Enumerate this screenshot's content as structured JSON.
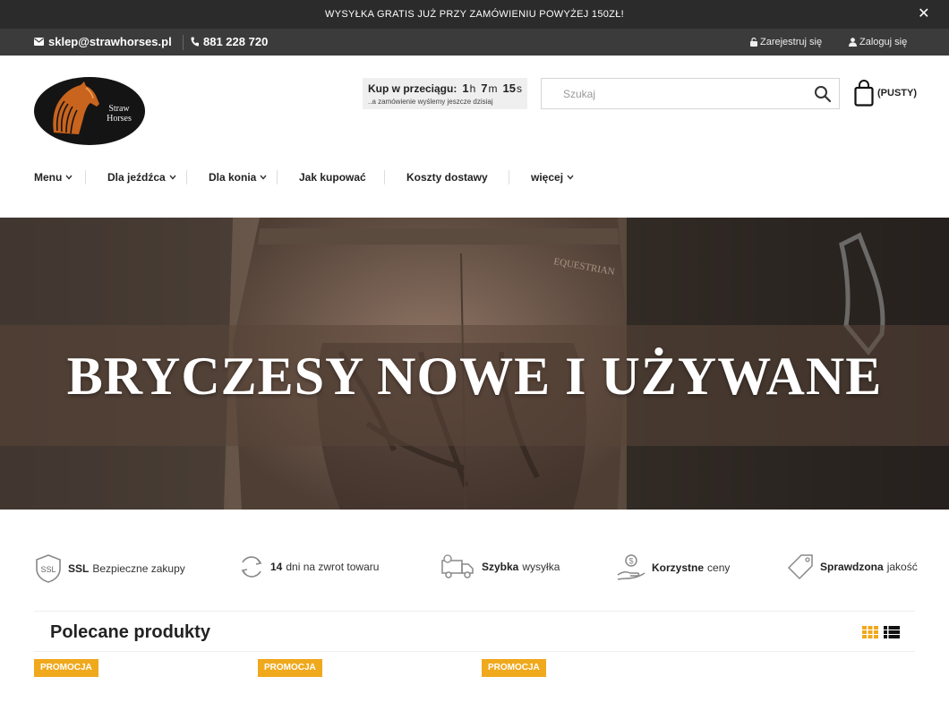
{
  "promo_bar": {
    "text": "WYSYŁKA GRATIS JUŻ PRZY ZAMÓWIENIU POWYŻEJ 150ZŁ!",
    "close_icon": "close-icon"
  },
  "contact": {
    "email": "sklep@strawhorses.pl",
    "phone": "881 228 720"
  },
  "account": {
    "register": "Zarejestruj się",
    "login": "Zaloguj się"
  },
  "logo": {
    "line1": "Straw",
    "line2": "Horses"
  },
  "timer": {
    "label": "Kup w przeciągu:",
    "hours": "1",
    "hours_unit": "h",
    "minutes": "7",
    "minutes_unit": "m",
    "seconds": "15",
    "seconds_unit": "s",
    "subtext": "..a zamówienie wyślemy jeszcze dzisiaj"
  },
  "search": {
    "placeholder": "Szukaj",
    "value": ""
  },
  "cart": {
    "label": "(PUSTY)"
  },
  "nav": {
    "items": [
      {
        "label": "Menu"
      },
      {
        "label": "Dla jeźdźca"
      },
      {
        "label": "Dla konia"
      },
      {
        "label": "Jak kupować"
      },
      {
        "label": "Koszty dostawy"
      },
      {
        "label": "więcej"
      }
    ]
  },
  "banner": {
    "title": "BRYCZESY NOWE I UŻYWANE",
    "garment_text": "EQUESTRIAN"
  },
  "features": [
    {
      "bold": "SSL",
      "text": "Bezpieczne zakupy",
      "icon": "ssl-shield-icon",
      "icon_text": "SSL"
    },
    {
      "bold": "14",
      "text": "dni na zwrot towaru",
      "icon": "return-arrows-icon"
    },
    {
      "bold": "Szybka",
      "text": "wysyłka",
      "icon": "delivery-truck-icon"
    },
    {
      "bold": "Korzystne",
      "text": "ceny",
      "icon": "coin-hand-icon"
    },
    {
      "bold": "Sprawdzona",
      "text": "jakość",
      "icon": "price-tag-icon"
    }
  ],
  "products": {
    "title": "Polecane produkty",
    "view_grid_icon": "grid-view-icon",
    "view_list_icon": "list-view-icon",
    "promo_label": "PROMOCJA",
    "promo_tags": [
      "PROMOCJA",
      "PROMOCJA",
      "PROMOCJA"
    ]
  },
  "colors": {
    "promo_bar_bg": "#2b2b2b",
    "contact_bar_bg": "#3b3b3b",
    "accent": "#f0a81c",
    "banner_bg": "#3a302a"
  }
}
